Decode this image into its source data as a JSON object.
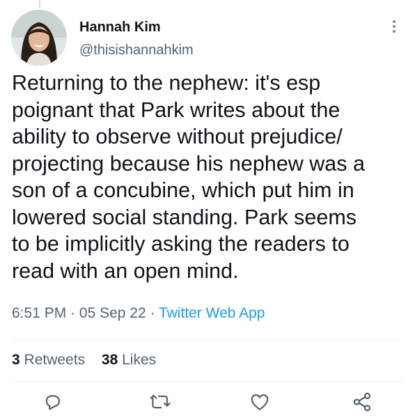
{
  "author": {
    "name": "Hannah Kim",
    "handle": "@thisishannahkim"
  },
  "tweet": {
    "text": "Returning to the nephew: it's esp\npoignant that Park writes about the\nability to observe without prejudice/\nprojecting because his nephew was a\nson of a concubine, which put him in\nlowered social standing. Park seems\nto be implicitly asking the readers to\nread with an open mind."
  },
  "meta": {
    "time": "6:51 PM",
    "date": "05 Sep 22",
    "source": "Twitter Web App",
    "separator": " · "
  },
  "stats": {
    "retweets_count": "3",
    "retweets_label": "Retweets",
    "likes_count": "38",
    "likes_label": "Likes"
  },
  "icons": {
    "more": "more-vertical-icon",
    "reply": "reply-icon",
    "retweet": "retweet-icon",
    "like": "heart-icon",
    "share": "share-icon"
  },
  "colors": {
    "text": "#0f1419",
    "secondary": "#536471",
    "link": "#1d9bf0",
    "divider": "#eff3f4"
  }
}
